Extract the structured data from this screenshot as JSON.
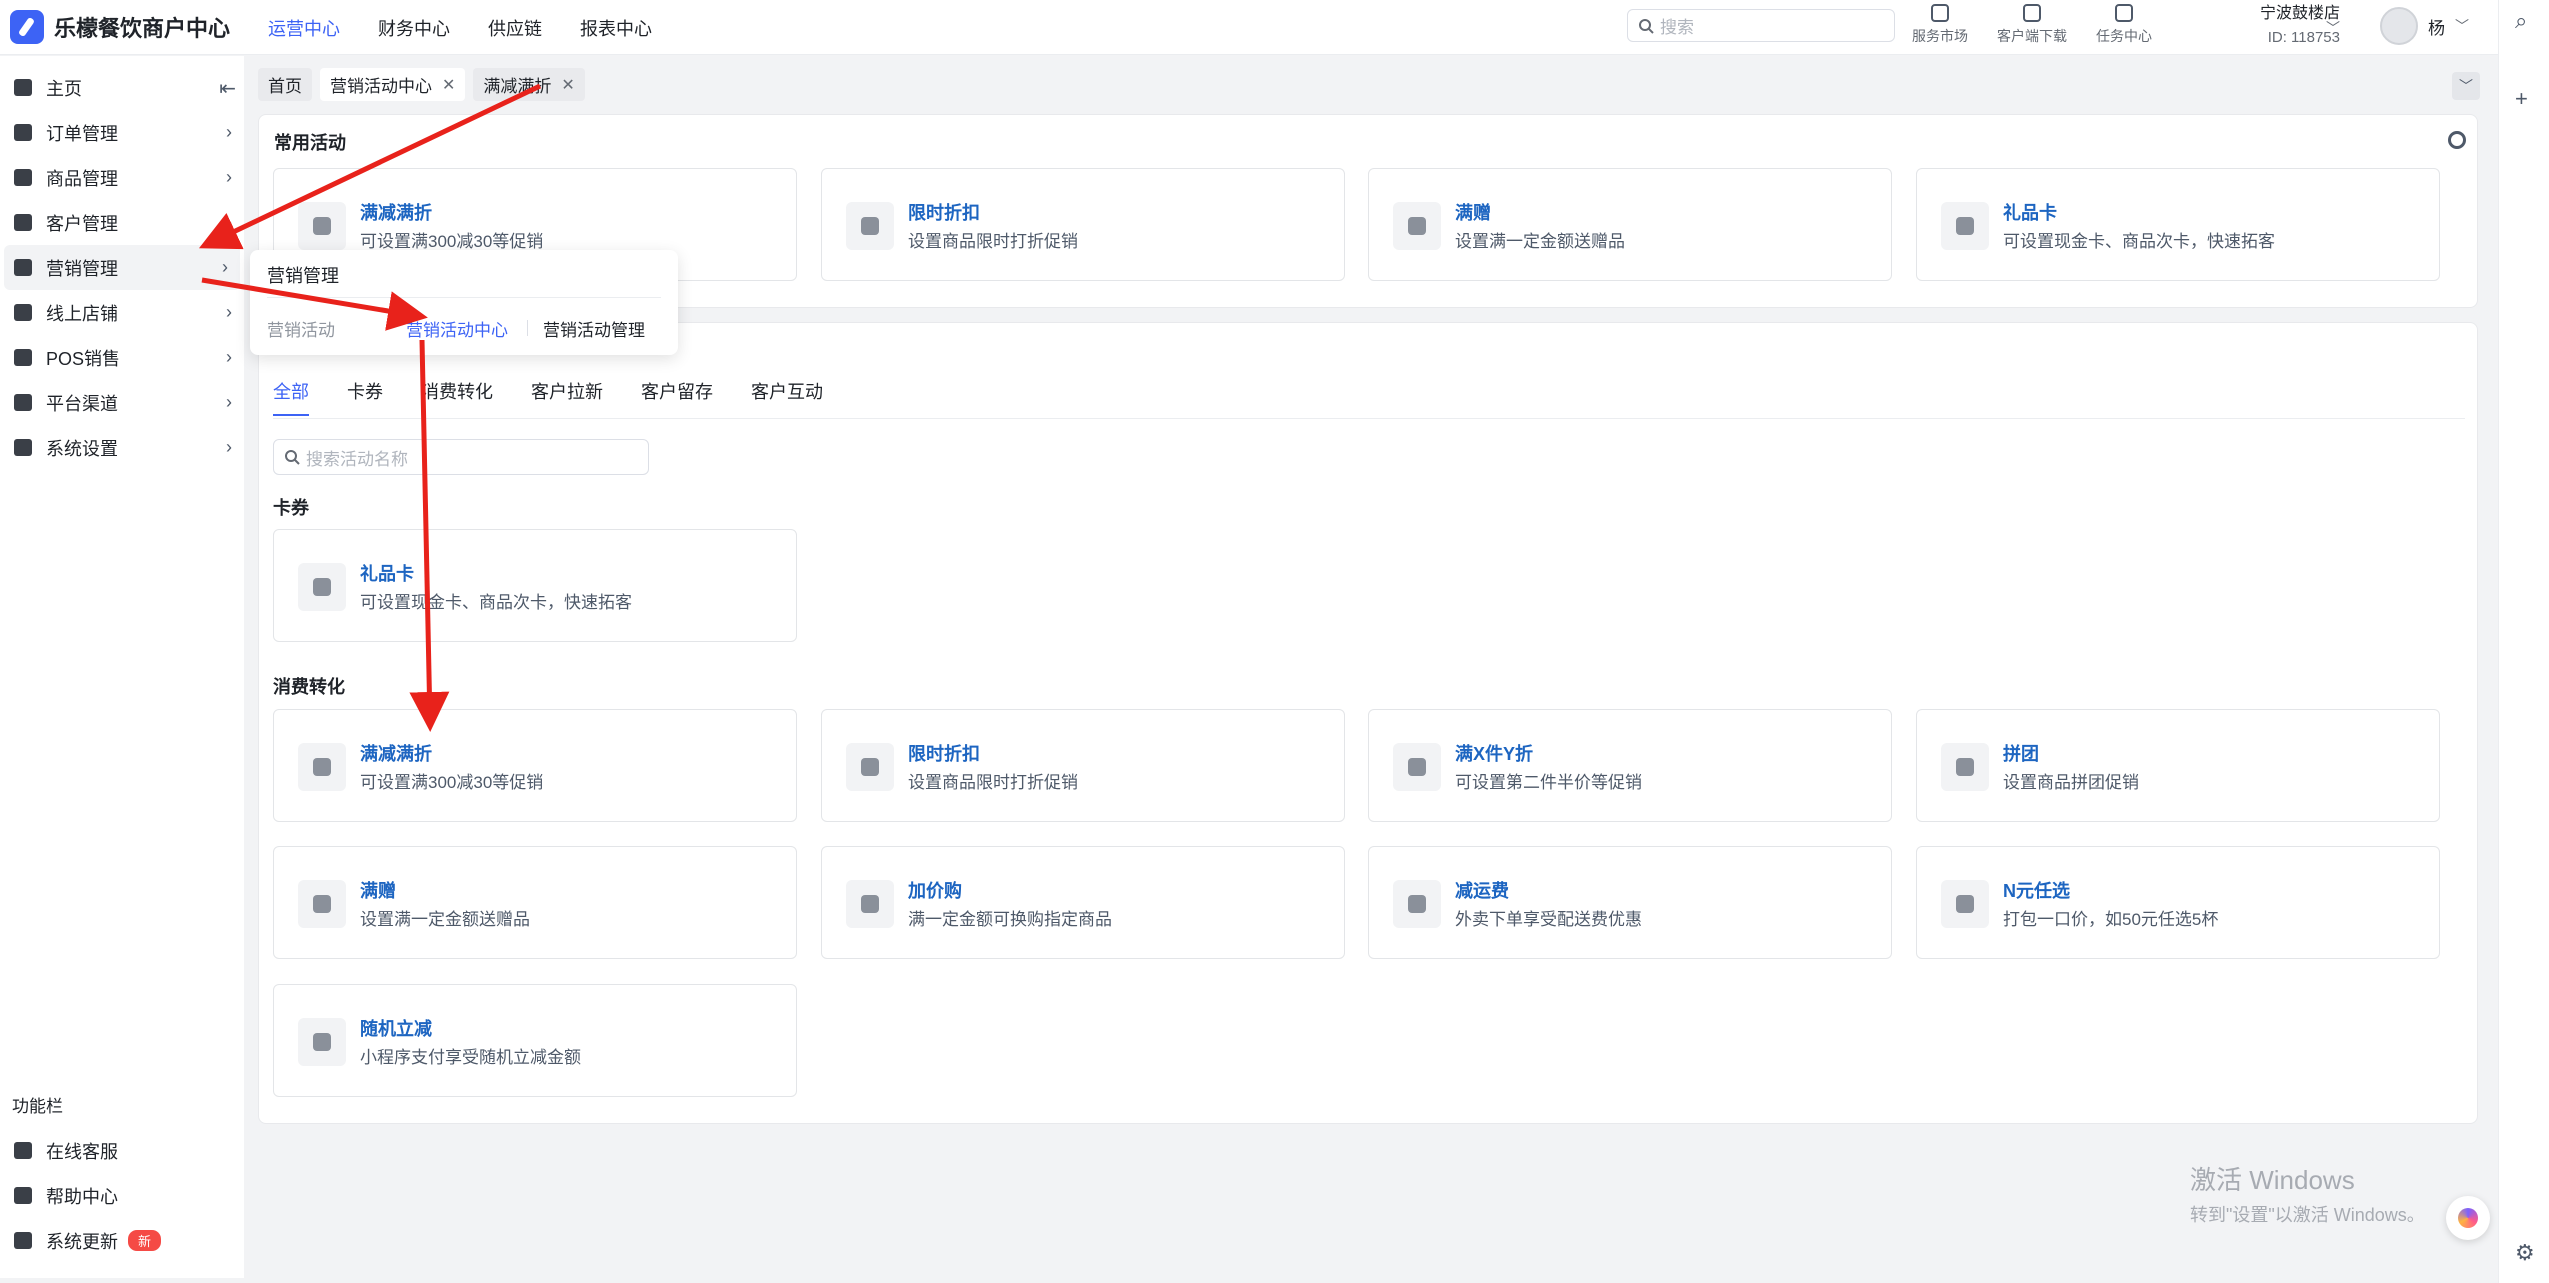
{
  "app": {
    "title": "乐檬餐饮商户中心"
  },
  "topnav": [
    "运营中心",
    "财务中心",
    "供应链",
    "报表中心"
  ],
  "search": {
    "placeholder": "搜索"
  },
  "tools": [
    "服务市场",
    "客户端下载",
    "任务中心"
  ],
  "store": {
    "name": "宁波鼓楼店",
    "id": "ID: 118753"
  },
  "user": {
    "name": "杨"
  },
  "sidebar": {
    "items": [
      "主页",
      "订单管理",
      "商品管理",
      "客户管理",
      "营销管理",
      "线上店铺",
      "POS销售",
      "平台渠道",
      "系统设置"
    ],
    "section": "功能栏",
    "footer": [
      "在线客服",
      "帮助中心",
      "系统更新"
    ],
    "new_badge": "新"
  },
  "tabs": [
    "首页",
    "营销活动中心",
    "满减满折"
  ],
  "popover": {
    "title": "营销管理",
    "group": "营销活动",
    "links": [
      "营销活动中心",
      "营销活动管理"
    ]
  },
  "common": {
    "title": "常用活动",
    "cards": [
      {
        "name": "满减满折",
        "desc": "可设置满300减30等促销"
      },
      {
        "name": "限时折扣",
        "desc": "设置商品限时打折促销"
      },
      {
        "name": "满赠",
        "desc": "设置满一定金额送赠品"
      },
      {
        "name": "礼品卡",
        "desc": "可设置现金卡、商品次卡，快速拓客"
      }
    ]
  },
  "filter": {
    "tabs": [
      "全部",
      "卡券",
      "消费转化",
      "客户拉新",
      "客户留存",
      "客户互动"
    ],
    "placeholder": "搜索活动名称"
  },
  "sections": [
    {
      "label": "卡券",
      "cards": [
        {
          "name": "礼品卡",
          "desc": "可设置现金卡、商品次卡，快速拓客"
        }
      ]
    },
    {
      "label": "消费转化",
      "cards": [
        {
          "name": "满减满折",
          "desc": "可设置满300减30等促销"
        },
        {
          "name": "限时折扣",
          "desc": "设置商品限时打折促销"
        },
        {
          "name": "满X件Y折",
          "desc": "可设置第二件半价等促销"
        },
        {
          "name": "拼团",
          "desc": "设置商品拼团促销"
        },
        {
          "name": "满赠",
          "desc": "设置满一定金额送赠品"
        },
        {
          "name": "加价购",
          "desc": "满一定金额可换购指定商品"
        },
        {
          "name": "减运费",
          "desc": "外卖下单享受配送费优惠"
        },
        {
          "name": "N元任选",
          "desc": "打包一口价，如50元任选5杯"
        },
        {
          "name": "随机立减",
          "desc": "小程序支付享受随机立减金额"
        }
      ]
    }
  ],
  "watermark": {
    "line1": "激活 Windows",
    "line2": "转到\"设置\"以激活 Windows。"
  },
  "colors": {
    "accent": "#3d63f5",
    "link": "#1d65c1",
    "arrow": "#e8221b"
  }
}
